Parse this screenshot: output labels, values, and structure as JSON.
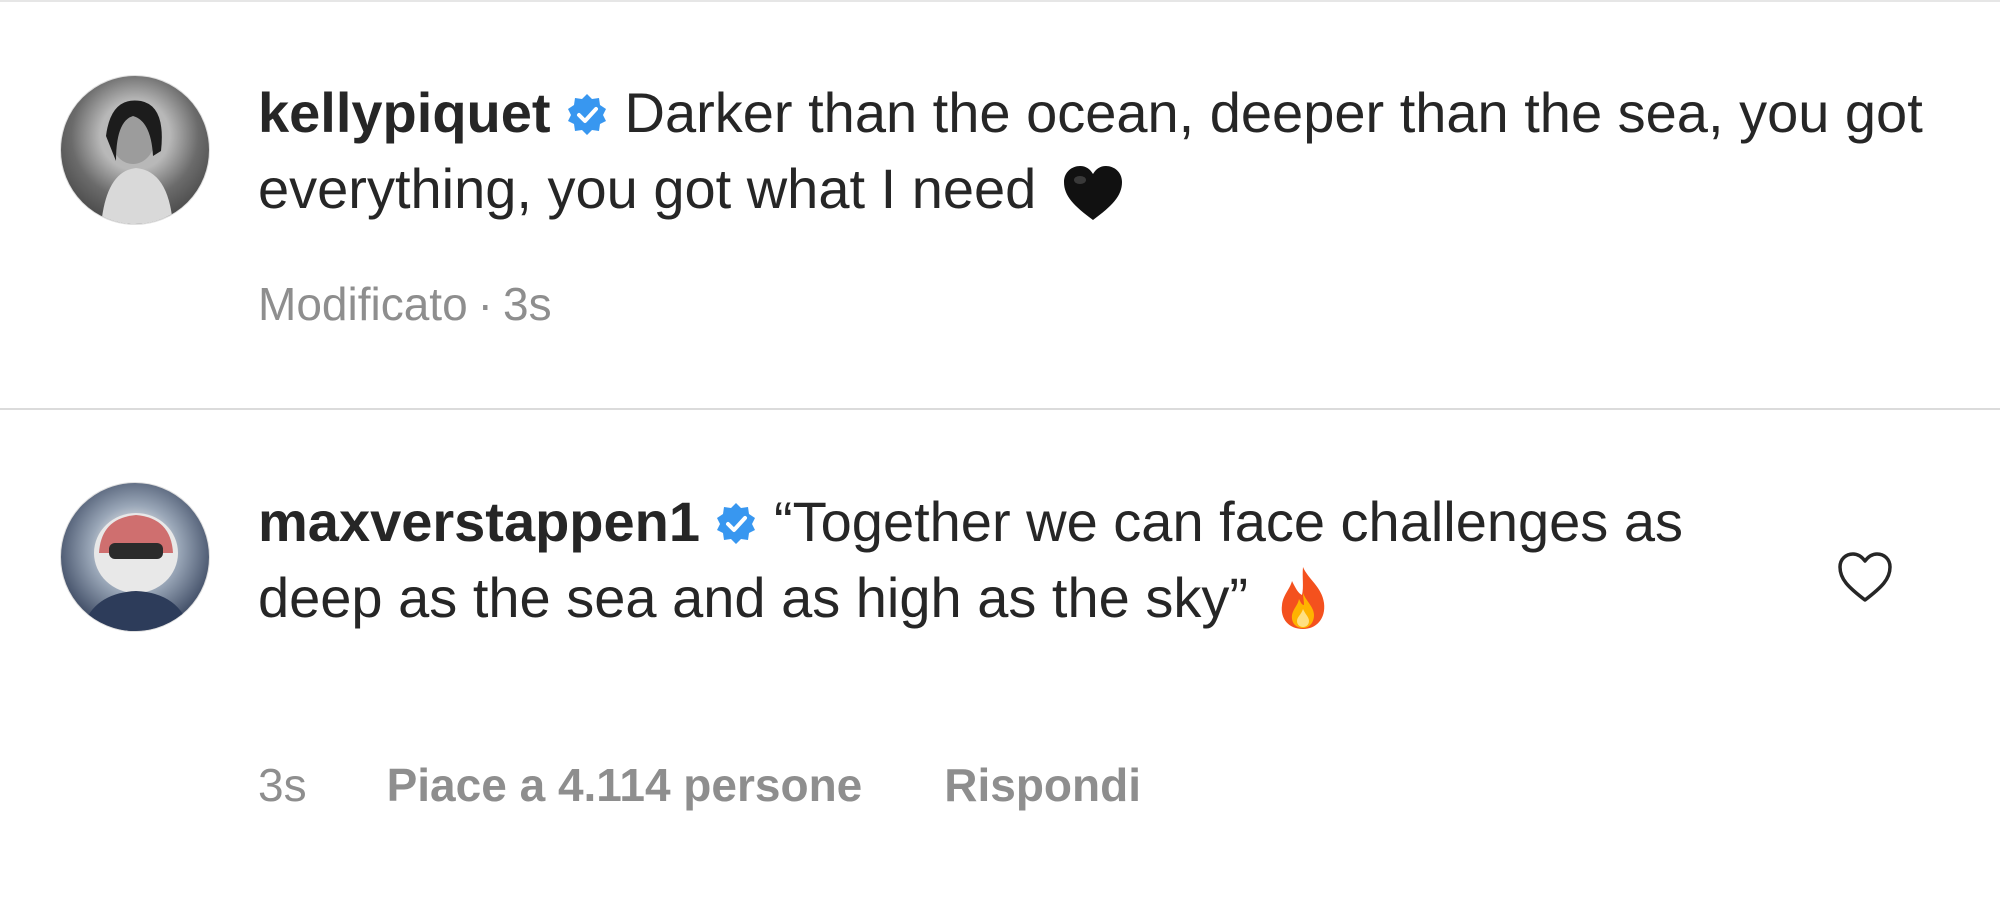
{
  "comments": [
    {
      "username": "kellypiquet",
      "verified": true,
      "text": "Darker than the ocean, deeper than the sea, you got everything, you got what I need",
      "emoji": "black-heart",
      "meta": {
        "edited": "Modificato",
        "separator": "·",
        "time": "3s"
      }
    },
    {
      "username": "maxverstappen1",
      "verified": true,
      "text": "“Together we can face challenges as deep as the sea and as high as the sky”",
      "emoji": "fire",
      "meta": {
        "time": "3s",
        "likes": "Piace a 4.114 persone",
        "reply": "Rispondi"
      }
    }
  ],
  "icons": {
    "verified": "verified-badge-icon",
    "like": "heart-outline-icon"
  },
  "colors": {
    "verified": "#3897f0",
    "meta_text": "#8e8e8e",
    "text": "#262626",
    "divider": "#dbdbdb"
  }
}
